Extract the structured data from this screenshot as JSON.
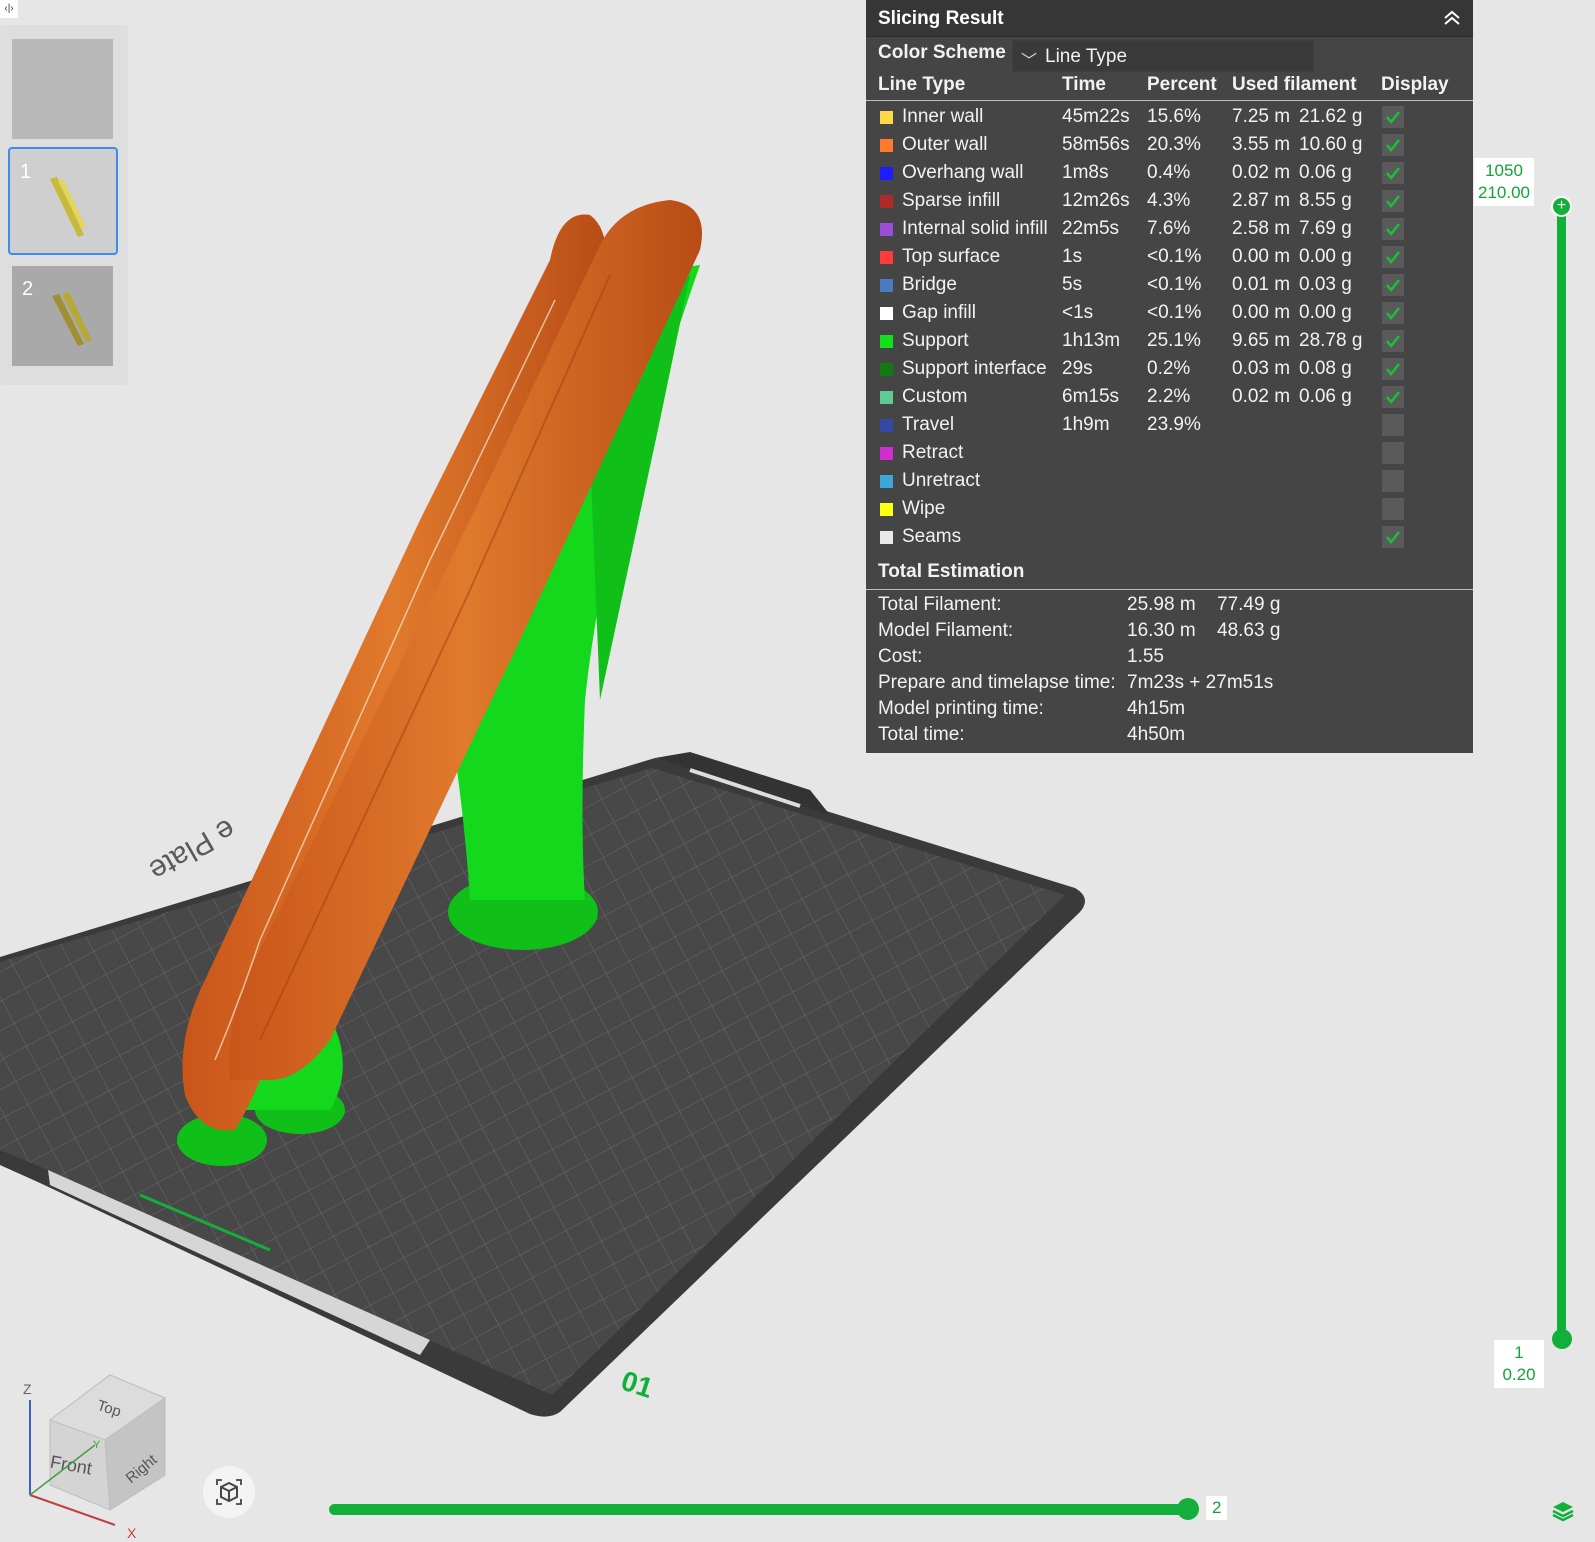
{
  "toggle_glyph": "‹|›",
  "plates": [
    {
      "label": ""
    },
    {
      "label": "1"
    },
    {
      "label": "2"
    }
  ],
  "panel": {
    "title": "Slicing Result",
    "color_scheme_label": "Color Scheme",
    "color_scheme_value": "Line Type",
    "headers": {
      "line_type": "Line Type",
      "time": "Time",
      "percent": "Percent",
      "used_filament": "Used filament",
      "display": "Display"
    },
    "rows": [
      {
        "name": "Inner wall",
        "color": "#ffd84a",
        "time": "45m22s",
        "percent": "15.6%",
        "length": "7.25 m",
        "weight": "21.62 g",
        "checked": true
      },
      {
        "name": "Outer wall",
        "color": "#ff7a2e",
        "time": "58m56s",
        "percent": "20.3%",
        "length": "3.55 m",
        "weight": "10.60 g",
        "checked": true
      },
      {
        "name": "Overhang wall",
        "color": "#1c1cff",
        "time": "1m8s",
        "percent": "0.4%",
        "length": "0.02 m",
        "weight": "0.06 g",
        "checked": true
      },
      {
        "name": "Sparse infill",
        "color": "#b02828",
        "time": "12m26s",
        "percent": "4.3%",
        "length": "2.87 m",
        "weight": "8.55 g",
        "checked": true
      },
      {
        "name": "Internal solid infill",
        "color": "#9a4ed8",
        "time": "22m5s",
        "percent": "7.6%",
        "length": "2.58 m",
        "weight": "7.69 g",
        "checked": true
      },
      {
        "name": "Top surface",
        "color": "#ff3b3b",
        "time": "1s",
        "percent": "<0.1%",
        "length": "0.00 m",
        "weight": "0.00 g",
        "checked": true
      },
      {
        "name": "Bridge",
        "color": "#4a7bc0",
        "time": "5s",
        "percent": "<0.1%",
        "length": "0.01 m",
        "weight": "0.03 g",
        "checked": true
      },
      {
        "name": "Gap infill",
        "color": "#ffffff",
        "time": "<1s",
        "percent": "<0.1%",
        "length": "0.00 m",
        "weight": "0.00 g",
        "checked": true
      },
      {
        "name": "Support",
        "color": "#12e01a",
        "time": "1h13m",
        "percent": "25.1%",
        "length": "9.65 m",
        "weight": "28.78 g",
        "checked": true
      },
      {
        "name": "Support interface",
        "color": "#127a12",
        "time": "29s",
        "percent": "0.2%",
        "length": "0.03 m",
        "weight": "0.08 g",
        "checked": true
      },
      {
        "name": "Custom",
        "color": "#5ecb94",
        "time": "6m15s",
        "percent": "2.2%",
        "length": "0.02 m",
        "weight": "0.06 g",
        "checked": true
      },
      {
        "name": "Travel",
        "color": "#3548a6",
        "time": "1h9m",
        "percent": "23.9%",
        "length": "",
        "weight": "",
        "checked": false
      },
      {
        "name": "Retract",
        "color": "#d12ed1",
        "time": "",
        "percent": "",
        "length": "",
        "weight": "",
        "checked": false
      },
      {
        "name": "Unretract",
        "color": "#3ca8d8",
        "time": "",
        "percent": "",
        "length": "",
        "weight": "",
        "checked": false
      },
      {
        "name": "Wipe",
        "color": "#ffff10",
        "time": "",
        "percent": "",
        "length": "",
        "weight": "",
        "checked": false
      },
      {
        "name": "Seams",
        "color": "#e8e8e8",
        "time": "",
        "percent": "",
        "length": "",
        "weight": "",
        "checked": true
      }
    ],
    "total_title": "Total Estimation",
    "totals": [
      {
        "label": "Total Filament:",
        "v1": "25.98 m",
        "v2": "77.49 g"
      },
      {
        "label": "Model Filament:",
        "v1": "16.30 m",
        "v2": "48.63 g"
      },
      {
        "label": "Cost:",
        "v1": "1.55",
        "v2": ""
      },
      {
        "label": "Prepare and timelapse time:",
        "v1": "7m23s + 27m51s",
        "v2": ""
      },
      {
        "label": "Model printing time:",
        "v1": "4h15m",
        "v2": ""
      },
      {
        "label": "Total time:",
        "v1": "4h50m",
        "v2": ""
      }
    ]
  },
  "layer_slider": {
    "top_layer": "1050",
    "top_height": "210.00",
    "bottom_layer": "1",
    "bottom_height": "0.20"
  },
  "move_slider": {
    "value": "2"
  },
  "plate_number": "01",
  "view_cube": {
    "top": "Top",
    "front": "Front",
    "right": "Right",
    "axis_x": "X",
    "axis_y": "Y",
    "axis_z": "Z"
  },
  "colors": {
    "accent": "#12b03a",
    "outer_wall": "#d9651f",
    "support": "#12e01a",
    "bed": "#4a4a4a",
    "panel_bg": "#454545"
  }
}
